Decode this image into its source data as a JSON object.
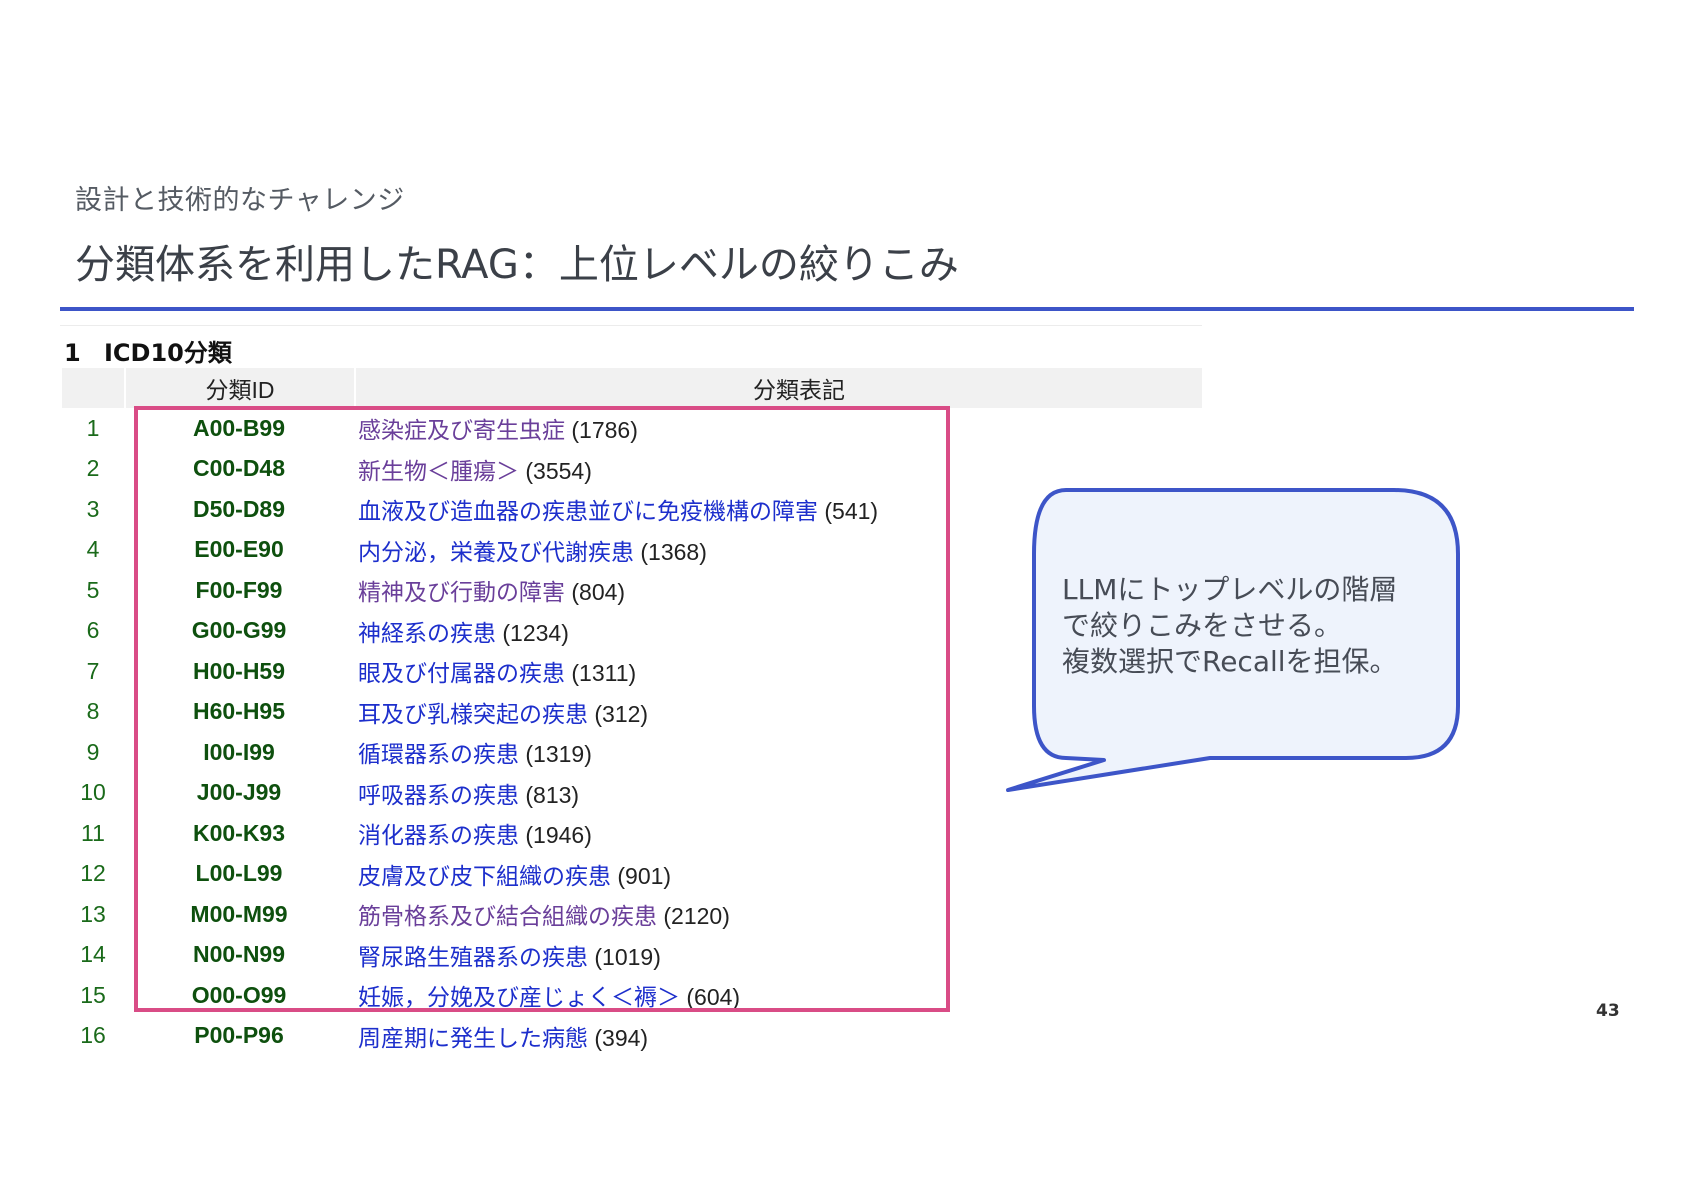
{
  "slide": {
    "subtitle": "設計と技術的なチャレンジ",
    "title": "分類体系を利用したRAG：上位レベルの絞りこみ",
    "page_number": "43"
  },
  "section": {
    "number": "1",
    "heading": "ICD10分類"
  },
  "table": {
    "headers": {
      "index": "",
      "id": "分類ID",
      "label": "分類表記"
    },
    "rows": [
      {
        "index": "1",
        "id": "A00-B99",
        "label": "感染症及び寄生虫症",
        "count": " (1786)",
        "visited": true
      },
      {
        "index": "2",
        "id": "C00-D48",
        "label": "新生物＜腫瘍＞",
        "count": " (3554)",
        "visited": true
      },
      {
        "index": "3",
        "id": "D50-D89",
        "label": "血液及び造血器の疾患並びに免疫機構の障害",
        "count": " (541)",
        "visited": false
      },
      {
        "index": "4",
        "id": "E00-E90",
        "label": "内分泌，栄養及び代謝疾患",
        "count": " (1368)",
        "visited": false
      },
      {
        "index": "5",
        "id": "F00-F99",
        "label": "精神及び行動の障害",
        "count": " (804)",
        "visited": true
      },
      {
        "index": "6",
        "id": "G00-G99",
        "label": "神経系の疾患",
        "count": " (1234)",
        "visited": false
      },
      {
        "index": "7",
        "id": "H00-H59",
        "label": "眼及び付属器の疾患",
        "count": " (1311)",
        "visited": false
      },
      {
        "index": "8",
        "id": "H60-H95",
        "label": "耳及び乳様突起の疾患",
        "count": " (312)",
        "visited": false
      },
      {
        "index": "9",
        "id": "I00-I99",
        "label": "循環器系の疾患",
        "count": " (1319)",
        "visited": false
      },
      {
        "index": "10",
        "id": "J00-J99",
        "label": "呼吸器系の疾患",
        "count": " (813)",
        "visited": false
      },
      {
        "index": "11",
        "id": "K00-K93",
        "label": "消化器系の疾患",
        "count": " (1946)",
        "visited": false
      },
      {
        "index": "12",
        "id": "L00-L99",
        "label": "皮膚及び皮下組織の疾患",
        "count": " (901)",
        "visited": false
      },
      {
        "index": "13",
        "id": "M00-M99",
        "label": "筋骨格系及び結合組織の疾患",
        "count": " (2120)",
        "visited": true
      },
      {
        "index": "14",
        "id": "N00-N99",
        "label": "腎尿路生殖器系の疾患",
        "count": " (1019)",
        "visited": false
      },
      {
        "index": "15",
        "id": "O00-O99",
        "label": "妊娠，分娩及び産じょく＜褥＞",
        "count": " (604)",
        "visited": false
      },
      {
        "index": "16",
        "id": "P00-P96",
        "label": "周産期に発生した病態",
        "count": " (394)",
        "visited": false
      }
    ]
  },
  "callout": {
    "lines": [
      "LLMにトップレベルの階層",
      "で絞りこみをさせる。",
      "複数選択でRecallを担保。"
    ]
  },
  "colors": {
    "accent_rule": "#3d55c8",
    "highlight_box": "#d94c86",
    "callout_fill": "#eef3fc",
    "callout_stroke": "#3d55c8",
    "link": "#1d2fcc",
    "link_visited": "#6a3f9a",
    "id_text": "#0e500e"
  }
}
